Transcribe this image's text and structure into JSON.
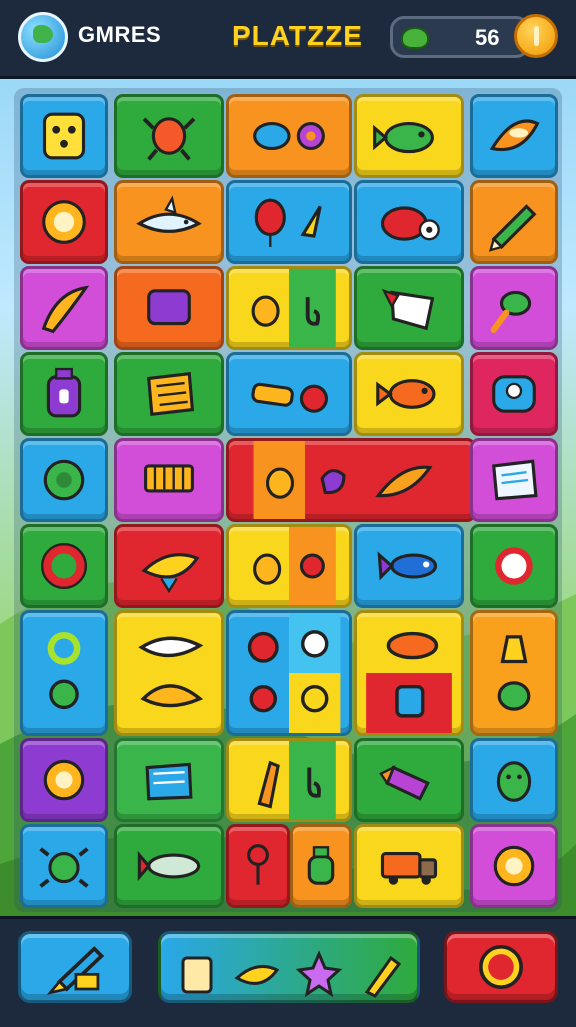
{
  "header": {
    "games_label": "GMRES",
    "title": "PLATZZE",
    "score_value": "56",
    "score_icon": "leaf-icon",
    "coin_icon": "coin-icon",
    "globe_icon": "globe-icon"
  },
  "colors": {
    "blue": "#2aa8e8",
    "green": "#2faa3c",
    "orange": "#f7931e",
    "yellow": "#f9d71c",
    "red": "#e0262e",
    "magenta": "#d24dd8",
    "purple": "#7d3bb5",
    "orange_red": "#f56a1f"
  },
  "board": {
    "rows": [
      [
        "yellow-block-icon",
        "crab-icon",
        "blue-fish-icon",
        "green-fish-icon",
        "boat-icon"
      ],
      [
        "sun-gear-icon",
        "shark-icon",
        "balloon-icon",
        "red-bird-icon",
        "pencil-icon"
      ],
      [
        "banana-icon",
        "purple-box-icon",
        "chick-icon",
        "flag-icon",
        "dragonfly-icon"
      ],
      [
        "bottle-icon",
        "crate-icon",
        "bread-icon",
        "orange-fish-icon",
        "robot-icon"
      ],
      [
        "green-sun-icon",
        "cart-icon",
        "duck-icon",
        "letter-icon",
        "carrot-icon"
      ],
      [
        "red-ring-icon",
        "yellow-fish-icon",
        "bee-icon",
        "rocket-fish-icon",
        "ring-icon"
      ],
      [
        "lime-ring-icon",
        "white-fish-icon",
        "apple-icon",
        "gear-icon",
        "red-fish-icon"
      ],
      [
        "book-icon",
        "corn-icon",
        "teddy-icon",
        "pencil-tube-icon",
        "green-egg-icon"
      ],
      [
        "bug-icon",
        "blimp-icon",
        "pin-icon",
        "jar-icon",
        "truck-icon"
      ]
    ]
  },
  "tray": {
    "left_button_icon": "paintbrush-icon",
    "items": [
      "milk-box-icon",
      "bird-icon",
      "star-icon",
      "crayon-icon"
    ],
    "right_button_icon": "record-button-icon"
  }
}
